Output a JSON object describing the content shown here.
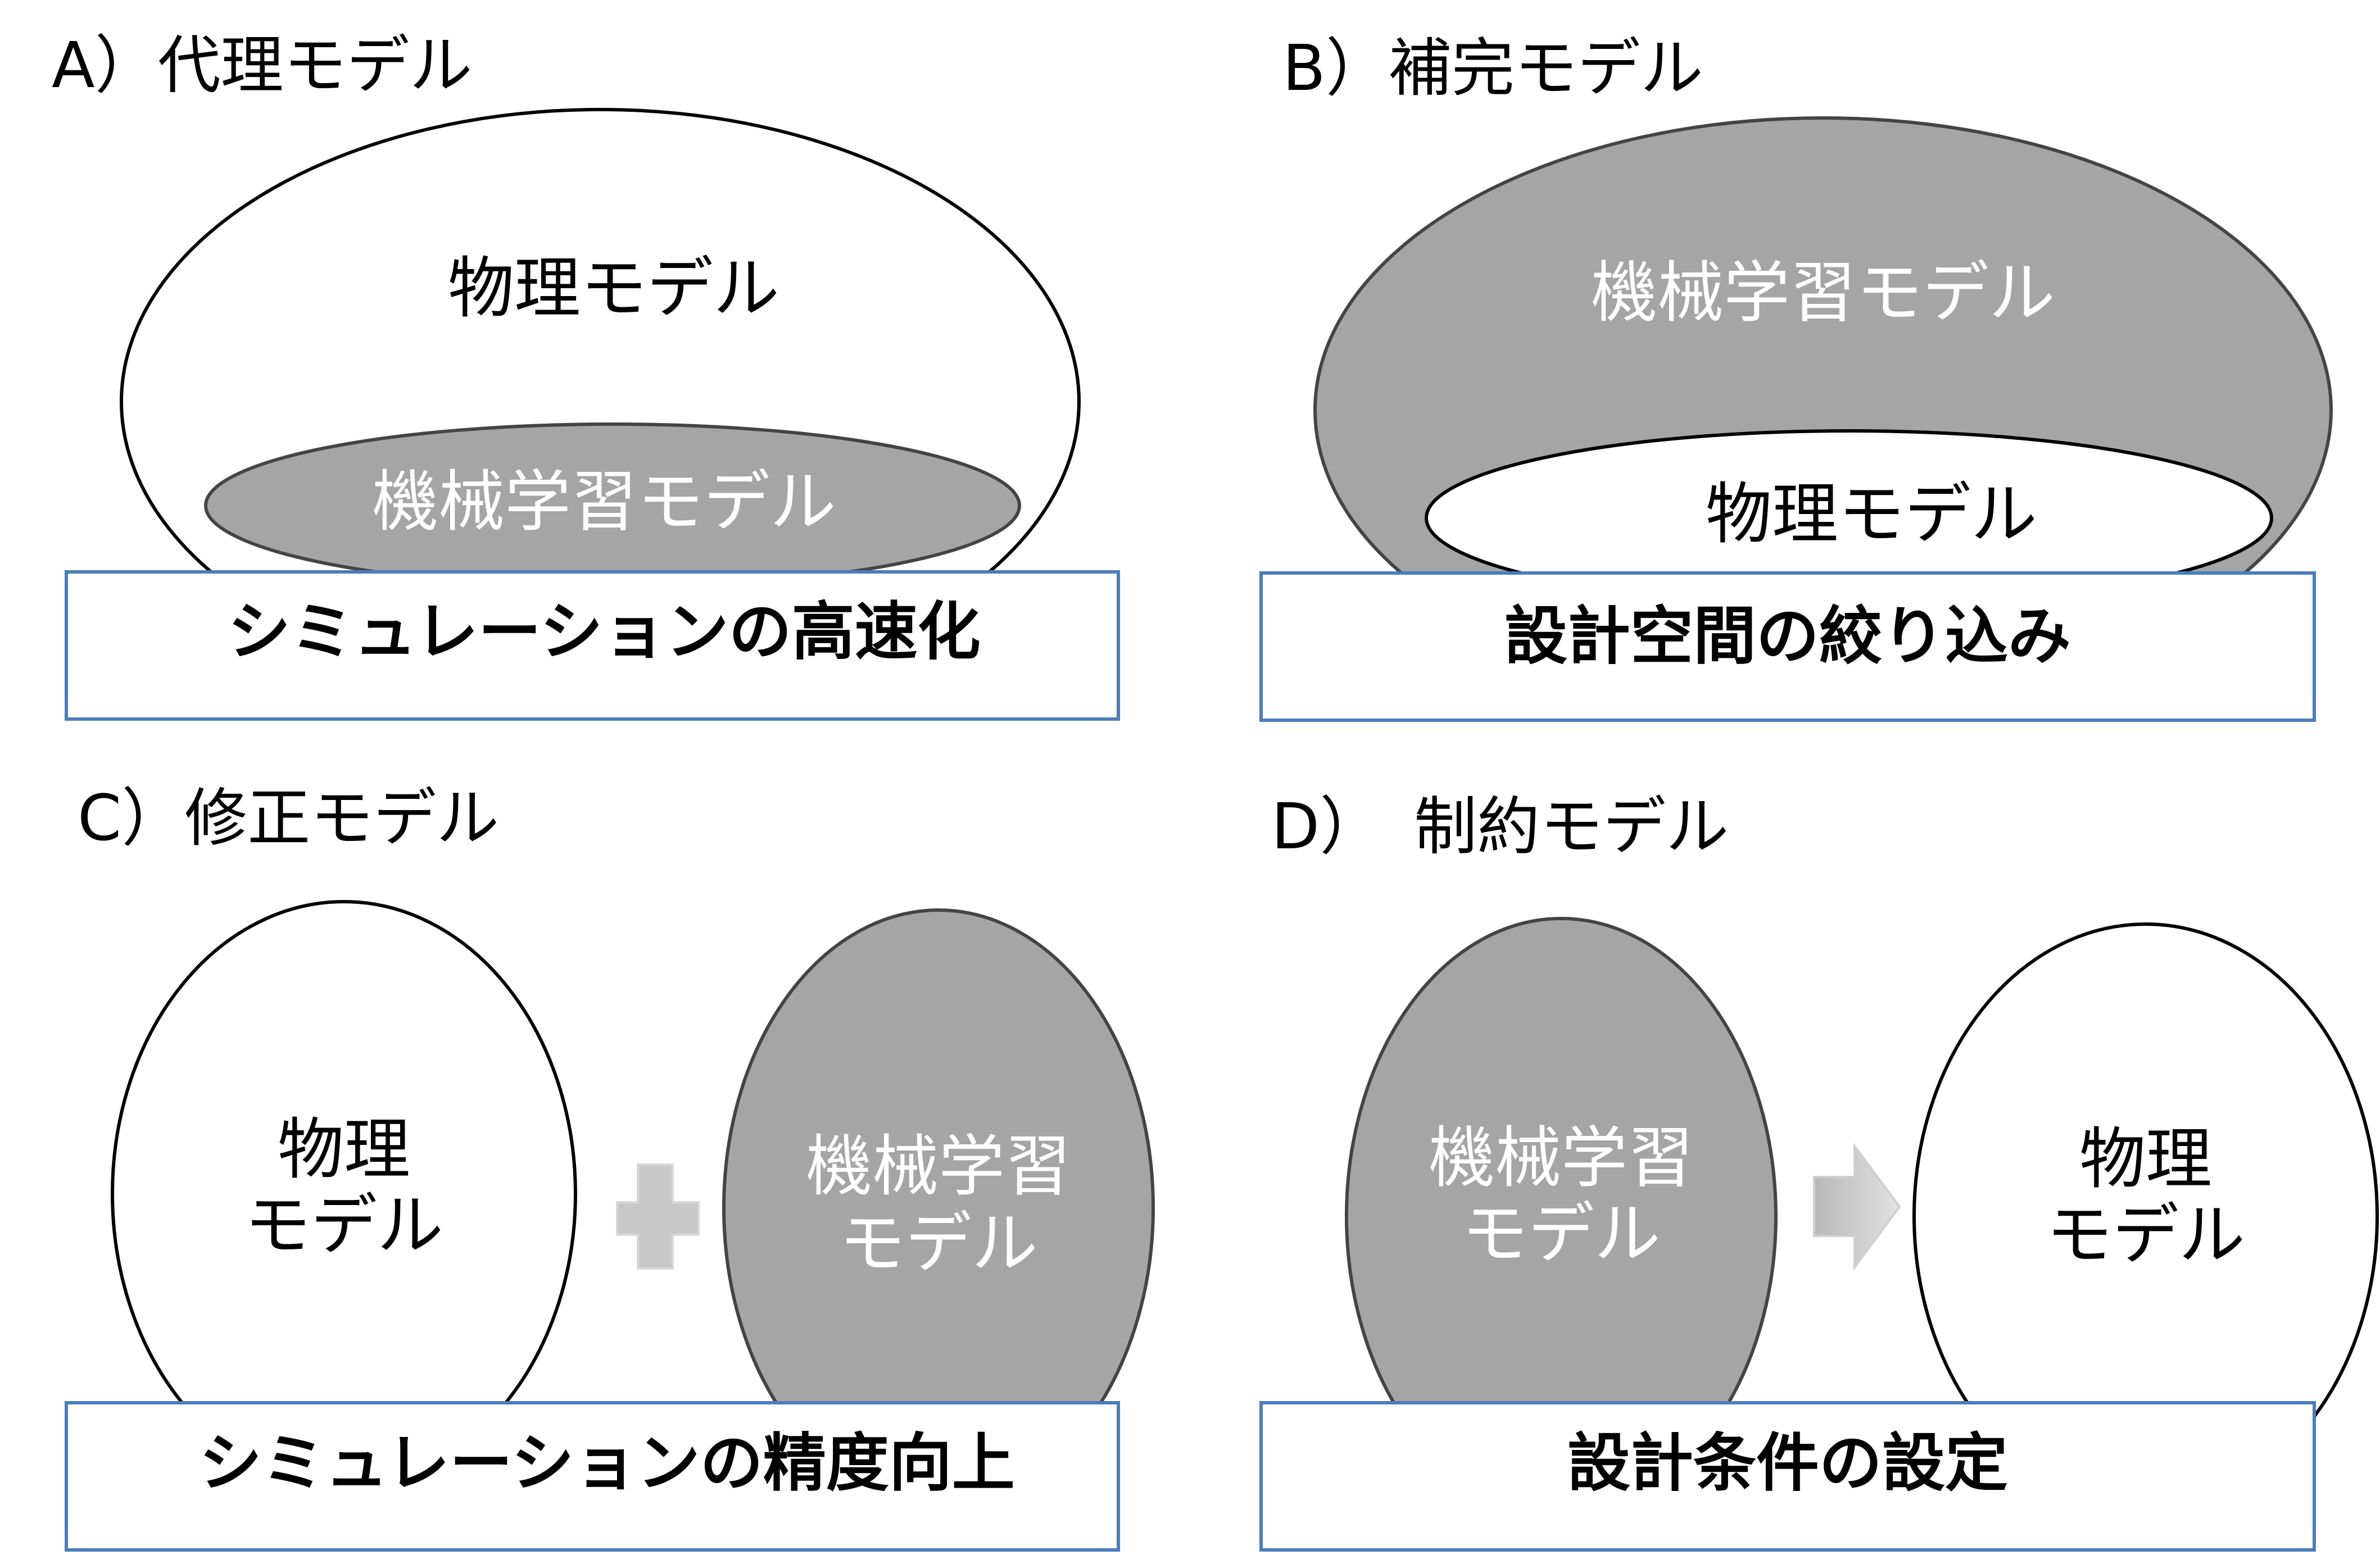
{
  "colors": {
    "ml_fill": "#a5a5a5",
    "ml_text": "#ffffff",
    "physics_fill": "#ffffff",
    "physics_text": "#000000",
    "outline": "#000000",
    "box_border": "#4a7ebb",
    "connector_fill": "#c8c8c8"
  },
  "panels": {
    "a": {
      "title": "A）代理モデル",
      "outer_label": "物理モデル",
      "inner_label": "機械学習モデル",
      "box_label": "シミュレーションの高速化"
    },
    "b": {
      "title": "B）補完モデル",
      "outer_label": "機械学習モデル",
      "inner_label": "物理モデル",
      "box_label": "設計空間の絞り込み"
    },
    "c": {
      "title": "C）修正モデル",
      "left_line1": "物理",
      "left_line2": "モデル",
      "right_line1": "機械学習",
      "right_line2": "モデル",
      "connector_icon": "plus-icon",
      "box_label": "シミュレーションの精度向上"
    },
    "d": {
      "title": "D）　制約モデル",
      "left_line1": "機械学習",
      "left_line2": "モデル",
      "right_line1": "物理",
      "right_line2": "モデル",
      "connector_icon": "arrow-right-icon",
      "box_label": "設計条件の設定"
    }
  }
}
